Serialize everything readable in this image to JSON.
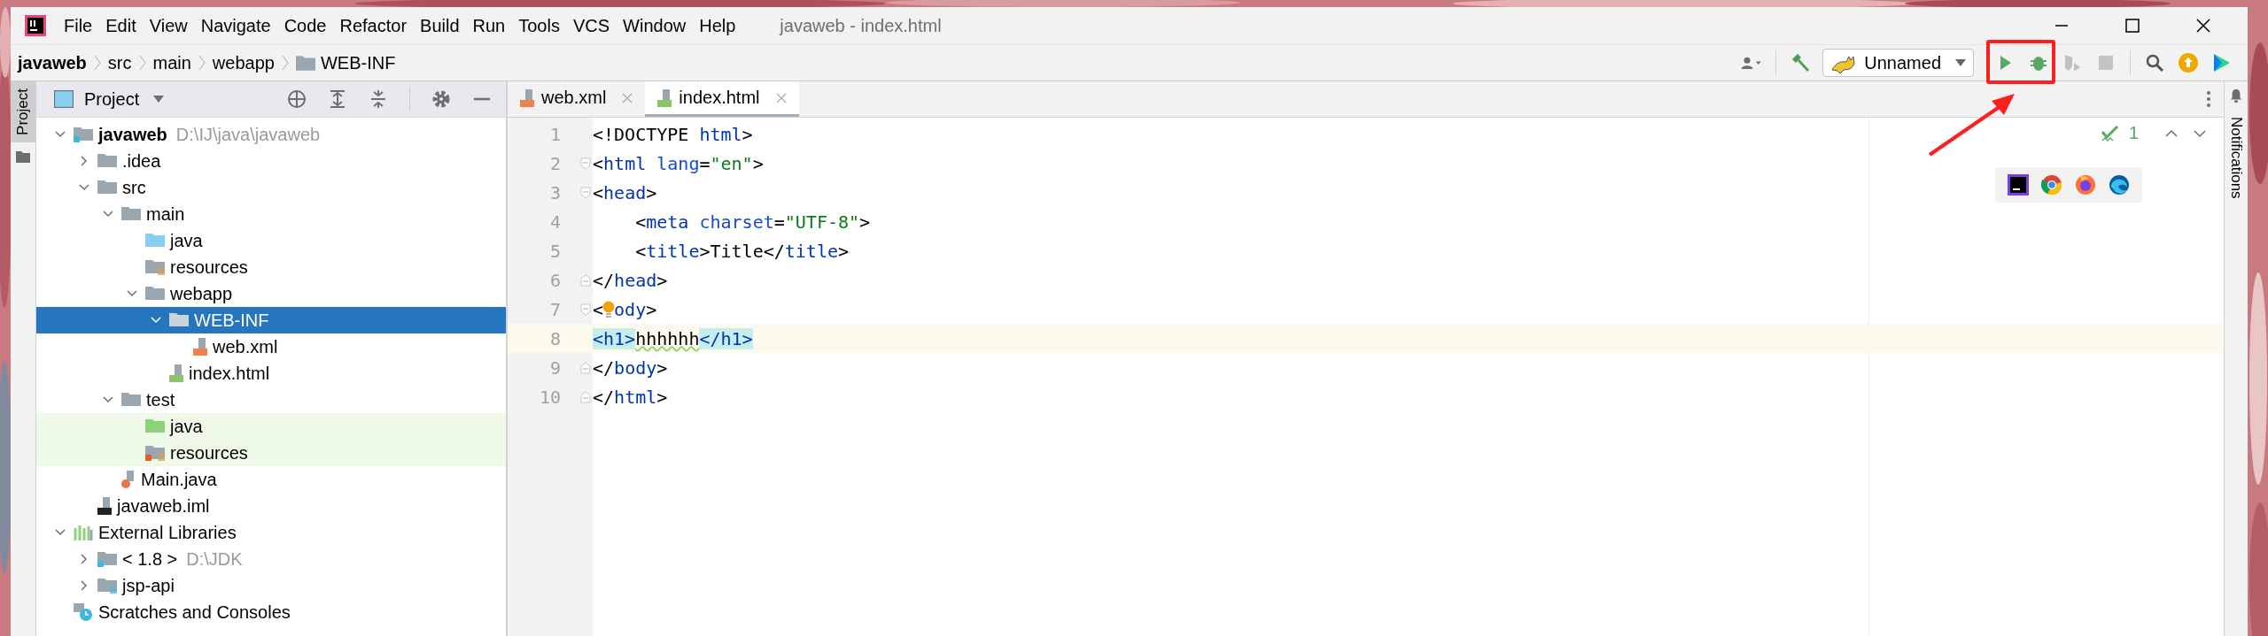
{
  "window": {
    "title": "javaweb - index.html"
  },
  "menu": [
    "File",
    "Edit",
    "View",
    "Navigate",
    "Code",
    "Refactor",
    "Build",
    "Run",
    "Tools",
    "VCS",
    "Window",
    "Help"
  ],
  "breadcrumbs": [
    {
      "label": "javaweb",
      "kind": "root"
    },
    {
      "label": "src",
      "kind": "dir"
    },
    {
      "label": "main",
      "kind": "dir"
    },
    {
      "label": "webapp",
      "kind": "dir"
    },
    {
      "label": "WEB-INF",
      "kind": "folder"
    }
  ],
  "toolbar": {
    "run_config": "Unnamed"
  },
  "side_stripes": {
    "left": "Project",
    "right": "Notifications"
  },
  "project_panel": {
    "title": "Project",
    "tree": [
      {
        "label": "javaweb",
        "note": "D:\\IJ\\java\\javaweb",
        "kind": "module",
        "expanded": true,
        "selected": false,
        "highlighted": false,
        "children": [
          {
            "label": ".idea",
            "kind": "folder",
            "expanded": false,
            "selected": false,
            "highlighted": false
          },
          {
            "label": "src",
            "kind": "folder",
            "expanded": true,
            "selected": false,
            "highlighted": false,
            "children": [
              {
                "label": "main",
                "kind": "folder",
                "expanded": true,
                "selected": false,
                "highlighted": false,
                "children": [
                  {
                    "label": "java",
                    "kind": "source",
                    "selected": false,
                    "highlighted": false
                  },
                  {
                    "label": "resources",
                    "kind": "resources",
                    "selected": false,
                    "highlighted": false
                  },
                  {
                    "label": "webapp",
                    "kind": "folder",
                    "expanded": true,
                    "selected": false,
                    "highlighted": false,
                    "children": [
                      {
                        "label": "WEB-INF",
                        "kind": "folder",
                        "expanded": true,
                        "selected": true,
                        "highlighted": false,
                        "children": [
                          {
                            "label": "web.xml",
                            "kind": "xml",
                            "selected": false,
                            "highlighted": false
                          }
                        ]
                      },
                      {
                        "label": "index.html",
                        "kind": "html",
                        "selected": false,
                        "highlighted": false
                      }
                    ]
                  }
                ]
              },
              {
                "label": "test",
                "kind": "folder",
                "expanded": true,
                "selected": false,
                "highlighted": false,
                "children": [
                  {
                    "label": "java",
                    "kind": "test",
                    "selected": false,
                    "highlighted": true
                  },
                  {
                    "label": "resources",
                    "kind": "test-resources",
                    "selected": false,
                    "highlighted": true
                  }
                ]
              },
              {
                "label": "Main.java",
                "kind": "java",
                "selected": false,
                "highlighted": false
              }
            ]
          },
          {
            "label": "javaweb.iml",
            "kind": "iml",
            "selected": false,
            "highlighted": false
          }
        ]
      },
      {
        "label": "External Libraries",
        "kind": "libraries",
        "expanded": true,
        "selected": false,
        "highlighted": false,
        "children": [
          {
            "label": "< 1.8 >",
            "note": "D:\\JDK",
            "kind": "sdk",
            "expanded": false,
            "selected": false,
            "highlighted": false
          },
          {
            "label": "jsp-api",
            "kind": "library",
            "expanded": false,
            "selected": false,
            "highlighted": false
          }
        ]
      },
      {
        "label": "Scratches and Consoles",
        "kind": "scratches",
        "selected": false,
        "highlighted": false
      }
    ]
  },
  "editor": {
    "tabs": [
      {
        "label": "web.xml",
        "kind": "xml",
        "selected": false
      },
      {
        "label": "index.html",
        "kind": "html",
        "selected": true
      }
    ],
    "inspections": "1",
    "lines": [
      {
        "number": "1",
        "fold_start": false,
        "fold_end": false,
        "current": false,
        "bulb": false,
        "tokens": [
          {
            "text": "<!DOCTYPE ",
            "kind": "punct"
          },
          {
            "text": "html",
            "kind": "tag"
          },
          {
            "text": ">",
            "kind": "punct"
          }
        ]
      },
      {
        "number": "2",
        "fold_start": true,
        "fold_end": false,
        "current": false,
        "bulb": false,
        "tokens": [
          {
            "text": "<",
            "kind": "punct"
          },
          {
            "text": "html ",
            "kind": "tag"
          },
          {
            "text": "lang",
            "kind": "attr"
          },
          {
            "text": "=",
            "kind": "punct"
          },
          {
            "text": "\"en\"",
            "kind": "value"
          },
          {
            "text": ">",
            "kind": "punct"
          }
        ]
      },
      {
        "number": "3",
        "fold_start": true,
        "fold_end": false,
        "current": false,
        "bulb": false,
        "tokens": [
          {
            "text": "<",
            "kind": "punct"
          },
          {
            "text": "head",
            "kind": "tag"
          },
          {
            "text": ">",
            "kind": "punct"
          }
        ]
      },
      {
        "number": "4",
        "fold_start": false,
        "fold_end": false,
        "current": false,
        "bulb": false,
        "tokens": [
          {
            "text": "    <",
            "kind": "punct"
          },
          {
            "text": "meta ",
            "kind": "tag"
          },
          {
            "text": "charset",
            "kind": "attr"
          },
          {
            "text": "=",
            "kind": "punct"
          },
          {
            "text": "\"UTF-8\"",
            "kind": "value"
          },
          {
            "text": ">",
            "kind": "punct"
          }
        ]
      },
      {
        "number": "5",
        "fold_start": false,
        "fold_end": false,
        "current": false,
        "bulb": false,
        "tokens": [
          {
            "text": "    <",
            "kind": "punct"
          },
          {
            "text": "title",
            "kind": "tag"
          },
          {
            "text": ">Title</",
            "kind": "punct"
          },
          {
            "text": "title",
            "kind": "tag"
          },
          {
            "text": ">",
            "kind": "punct"
          }
        ]
      },
      {
        "number": "6",
        "fold_start": false,
        "fold_end": true,
        "current": false,
        "bulb": false,
        "tokens": [
          {
            "text": "</",
            "kind": "punct"
          },
          {
            "text": "head",
            "kind": "tag"
          },
          {
            "text": ">",
            "kind": "punct"
          }
        ]
      },
      {
        "number": "7",
        "fold_start": true,
        "fold_end": false,
        "current": false,
        "bulb": true,
        "tokens": [
          {
            "text": "<",
            "kind": "punct"
          },
          {
            "text": "ody",
            "kind": "tag"
          },
          {
            "text": ">",
            "kind": "punct"
          }
        ]
      },
      {
        "number": "8",
        "fold_start": false,
        "fold_end": false,
        "current": true,
        "bulb": false,
        "tokens": [
          {
            "text": "<h1>",
            "kind": "match"
          },
          {
            "text": "hhhhhh",
            "kind": "typo"
          },
          {
            "text": "</h1>",
            "kind": "match"
          }
        ]
      },
      {
        "number": "9",
        "fold_start": false,
        "fold_end": true,
        "current": false,
        "bulb": false,
        "tokens": [
          {
            "text": "</",
            "kind": "punct"
          },
          {
            "text": "body",
            "kind": "tag"
          },
          {
            "text": ">",
            "kind": "punct"
          }
        ]
      },
      {
        "number": "10",
        "fold_start": false,
        "fold_end": true,
        "current": false,
        "bulb": false,
        "tokens": [
          {
            "text": "</",
            "kind": "punct"
          },
          {
            "text": "html",
            "kind": "tag"
          },
          {
            "text": ">",
            "kind": "punct"
          }
        ]
      }
    ]
  }
}
